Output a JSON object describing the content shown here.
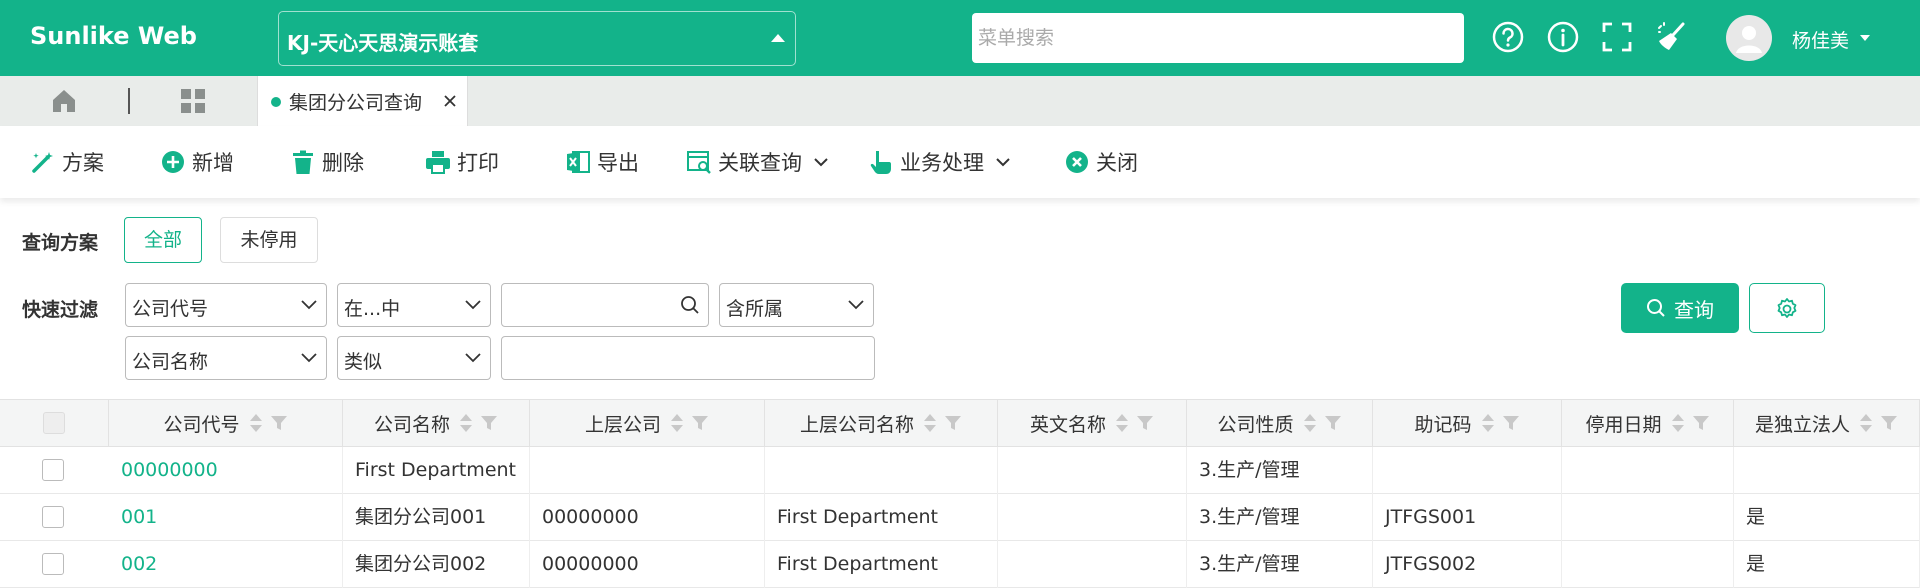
{
  "header": {
    "brand": "Sunlike Web",
    "account": "KJ-天心天思演示账套",
    "search_placeholder": "菜单搜索",
    "icons": [
      "help-circle-icon",
      "info-circle-icon",
      "fullscreen-icon",
      "broom-clean-icon"
    ],
    "user_name": "杨佳美"
  },
  "tabs": {
    "active_label": "集团分公司查询"
  },
  "toolbar": {
    "scheme": "方案",
    "add": "新增",
    "delete": "删除",
    "print": "打印",
    "export": "导出",
    "related_query": "关联查询",
    "business": "业务处理",
    "close": "关闭"
  },
  "filters": {
    "scheme_label": "查询方案",
    "scheme_all": "全部",
    "scheme_inactive": "未停用",
    "quick_label": "快速过滤",
    "row1": {
      "field": "公司代号",
      "operator": "在...中",
      "value": "",
      "scope": "含所属"
    },
    "row2": {
      "field": "公司名称",
      "operator": "类似",
      "value": ""
    },
    "query_label": "查询"
  },
  "table": {
    "columns": [
      "公司代号",
      "公司名称",
      "上层公司",
      "上层公司名称",
      "英文名称",
      "公司性质",
      "助记码",
      "停用日期",
      "是独立法人"
    ],
    "rows": [
      [
        "00000000",
        "First Department",
        "",
        "",
        "",
        "3.生产/管理",
        "",
        "",
        ""
      ],
      [
        "001",
        "集团分公司001",
        "00000000",
        "First Department",
        "",
        "3.生产/管理",
        "JTFGS001",
        "",
        "是"
      ],
      [
        "002",
        "集团分公司002",
        "00000000",
        "First Department",
        "",
        "3.生产/管理",
        "JTFGS002",
        "",
        "是"
      ]
    ]
  },
  "colors": {
    "brand": "#13b38a"
  }
}
